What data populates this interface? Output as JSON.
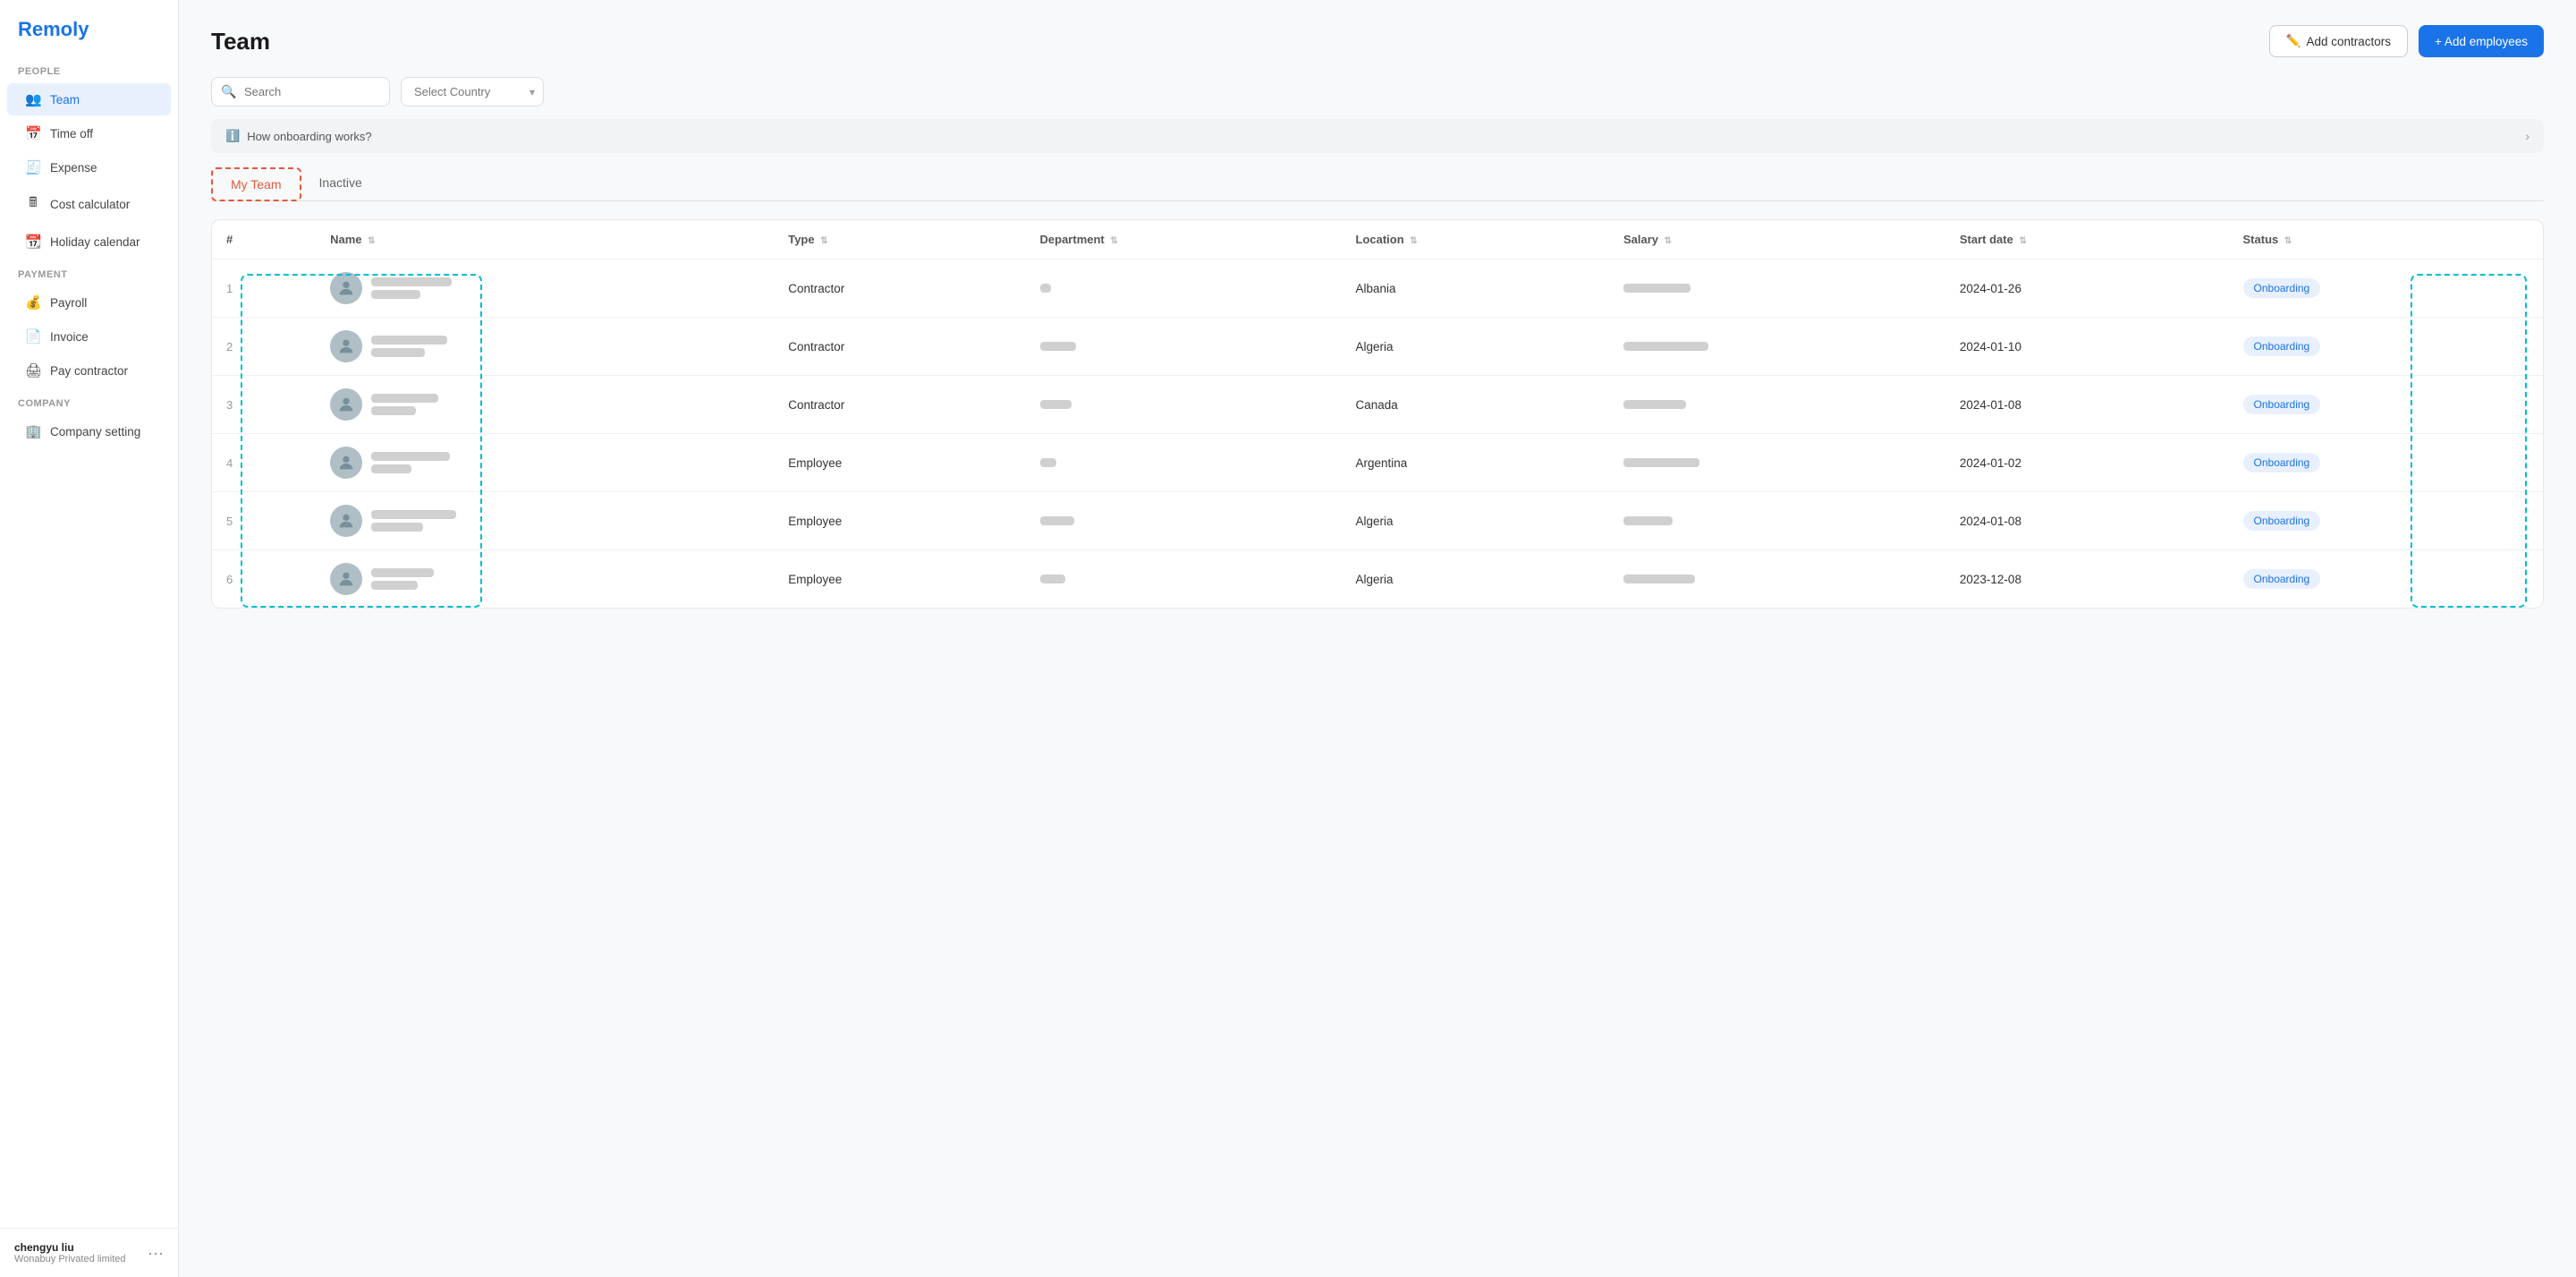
{
  "app": {
    "name": "Remoly"
  },
  "sidebar": {
    "sections": [
      {
        "label": "PEOPLE",
        "items": [
          {
            "id": "team",
            "label": "Team",
            "icon": "👥",
            "active": true
          },
          {
            "id": "time-off",
            "label": "Time off",
            "icon": "📅"
          },
          {
            "id": "expense",
            "label": "Expense",
            "icon": "🧾"
          },
          {
            "id": "cost-calculator",
            "label": "Cost calculator",
            "icon": "🖩"
          },
          {
            "id": "holiday-calendar",
            "label": "Holiday calendar",
            "icon": "📆"
          }
        ]
      },
      {
        "label": "PAYMENT",
        "items": [
          {
            "id": "payroll",
            "label": "Payroll",
            "icon": "💰"
          },
          {
            "id": "invoice",
            "label": "Invoice",
            "icon": "📄"
          },
          {
            "id": "pay-contractor",
            "label": "Pay contractor",
            "icon": "🖨"
          }
        ]
      },
      {
        "label": "COMPANY",
        "items": [
          {
            "id": "company-setting",
            "label": "Company setting",
            "icon": "🏢"
          }
        ]
      }
    ],
    "user": {
      "name": "chengyu liu",
      "company": "Wonabuy Privated limited"
    }
  },
  "page": {
    "title": "Team",
    "header_actions": {
      "add_contractors_label": "Add contractors",
      "add_employees_label": "+ Add employees"
    }
  },
  "filters": {
    "search_placeholder": "Search",
    "country_placeholder": "Select Country"
  },
  "info_banner": {
    "text": "How onboarding works?"
  },
  "tabs": [
    {
      "id": "my-team",
      "label": "My Team",
      "active": true
    },
    {
      "id": "inactive",
      "label": "Inactive",
      "active": false
    }
  ],
  "table": {
    "columns": [
      {
        "id": "num",
        "label": "#"
      },
      {
        "id": "name",
        "label": "Name"
      },
      {
        "id": "type",
        "label": "Type"
      },
      {
        "id": "department",
        "label": "Department"
      },
      {
        "id": "location",
        "label": "Location"
      },
      {
        "id": "salary",
        "label": "Salary"
      },
      {
        "id": "start_date",
        "label": "Start date"
      },
      {
        "id": "status",
        "label": "Status"
      }
    ],
    "rows": [
      {
        "num": "1",
        "type": "Contractor",
        "location": "Albania",
        "start_date": "2024-01-26",
        "status": "Onboarding"
      },
      {
        "num": "2",
        "type": "Contractor",
        "location": "Algeria",
        "start_date": "2024-01-10",
        "status": "Onboarding"
      },
      {
        "num": "3",
        "type": "Contractor",
        "location": "Canada",
        "start_date": "2024-01-08",
        "status": "Onboarding"
      },
      {
        "num": "4",
        "type": "Employee",
        "location": "Argentina",
        "start_date": "2024-01-02",
        "status": "Onboarding"
      },
      {
        "num": "5",
        "type": "Employee",
        "location": "Algeria",
        "start_date": "2024-01-08",
        "status": "Onboarding"
      },
      {
        "num": "6",
        "type": "Employee",
        "location": "Algeria",
        "start_date": "2023-12-08",
        "status": "Onboarding"
      }
    ]
  }
}
